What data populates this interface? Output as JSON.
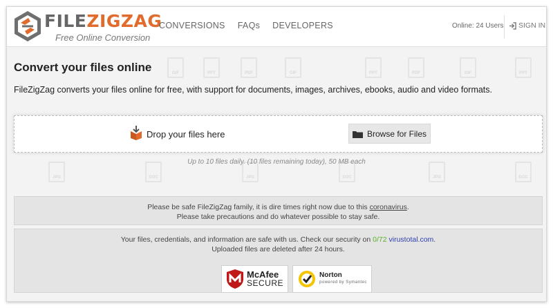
{
  "header": {
    "logo_file": "FILE",
    "logo_zigzag": "ZIGZAG",
    "tagline": "Free Online Conversion",
    "nav": [
      "CONVERSIONS",
      "FAQs",
      "DEVELOPERS"
    ],
    "online_users": "Online: 24 Users",
    "signin_label": "SIGN IN"
  },
  "main": {
    "title": "Convert your files online",
    "lead": "FileZigZag converts your files online for free, with support for documents, images, archives, ebooks, audio and video formats."
  },
  "upload": {
    "drop_label": "Drop your files here",
    "browse_label": "Browse for Files",
    "limits_note": "Up to 10 files daily. (10 files remaining today), 50 MB each"
  },
  "notice": {
    "line1_prefix": "Please be safe FileZigZag family, it is dire times right now due to this ",
    "line1_link": "coronavirus",
    "line1_suffix": ".",
    "line2": "Please take precautions and do whatever possible to stay safe."
  },
  "security": {
    "line1_prefix": "Your files, credentials, and information are safe with us. Check our security on ",
    "score": "0/72",
    "site": "virustotal.com",
    "line1_suffix": ".",
    "line2": "Uploaded files are deleted after 24 hours.",
    "mcafee_brand": "McAfee",
    "mcafee_secure": "SECURE",
    "norton_brand": "Norton",
    "norton_sub": "powered by Symantec"
  },
  "background_icon_labels": [
    "GIF",
    "PPT",
    "PDF",
    "GIF",
    "PPT",
    "PDF",
    "GIF",
    "PPT",
    "JPG",
    "DOC",
    "JPG",
    "DOC",
    "JPG",
    "DOC"
  ],
  "colors": {
    "brand_orange": "#e06b2d",
    "logo_gray": "#666666",
    "link_blue": "#2b3fb0",
    "score_green": "#5bb028",
    "box_gray": "#e4e4e4"
  }
}
